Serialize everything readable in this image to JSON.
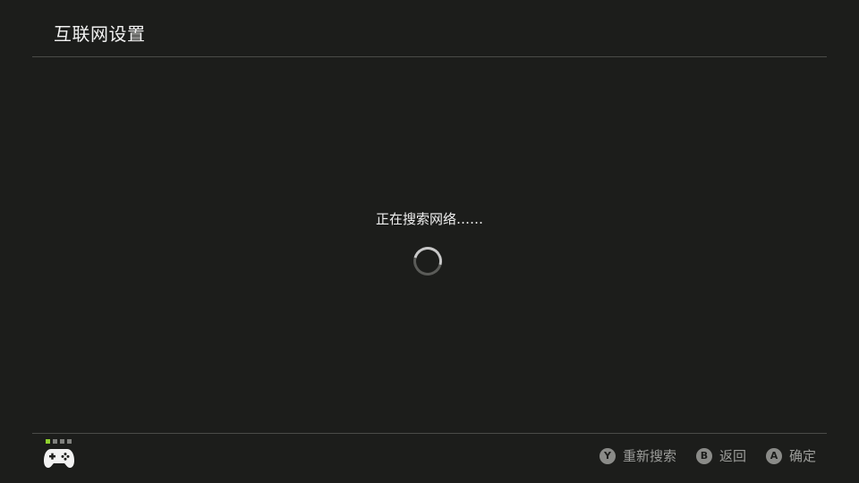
{
  "header": {
    "title": "互联网设置"
  },
  "status": {
    "message": "正在搜索网络……",
    "loading": true
  },
  "footer": {
    "player_indicator": {
      "total": 4,
      "active_index": 0,
      "active_color": "#8fd12e"
    },
    "controller_icon": "gamepad-icon",
    "hints": [
      {
        "button": "Y",
        "label": "重新搜索"
      },
      {
        "button": "B",
        "label": "返回"
      },
      {
        "button": "A",
        "label": "确定"
      }
    ]
  },
  "colors": {
    "background": "#1c1d1b",
    "divider": "#4a4b48",
    "hint_text": "#9c9d9a"
  }
}
